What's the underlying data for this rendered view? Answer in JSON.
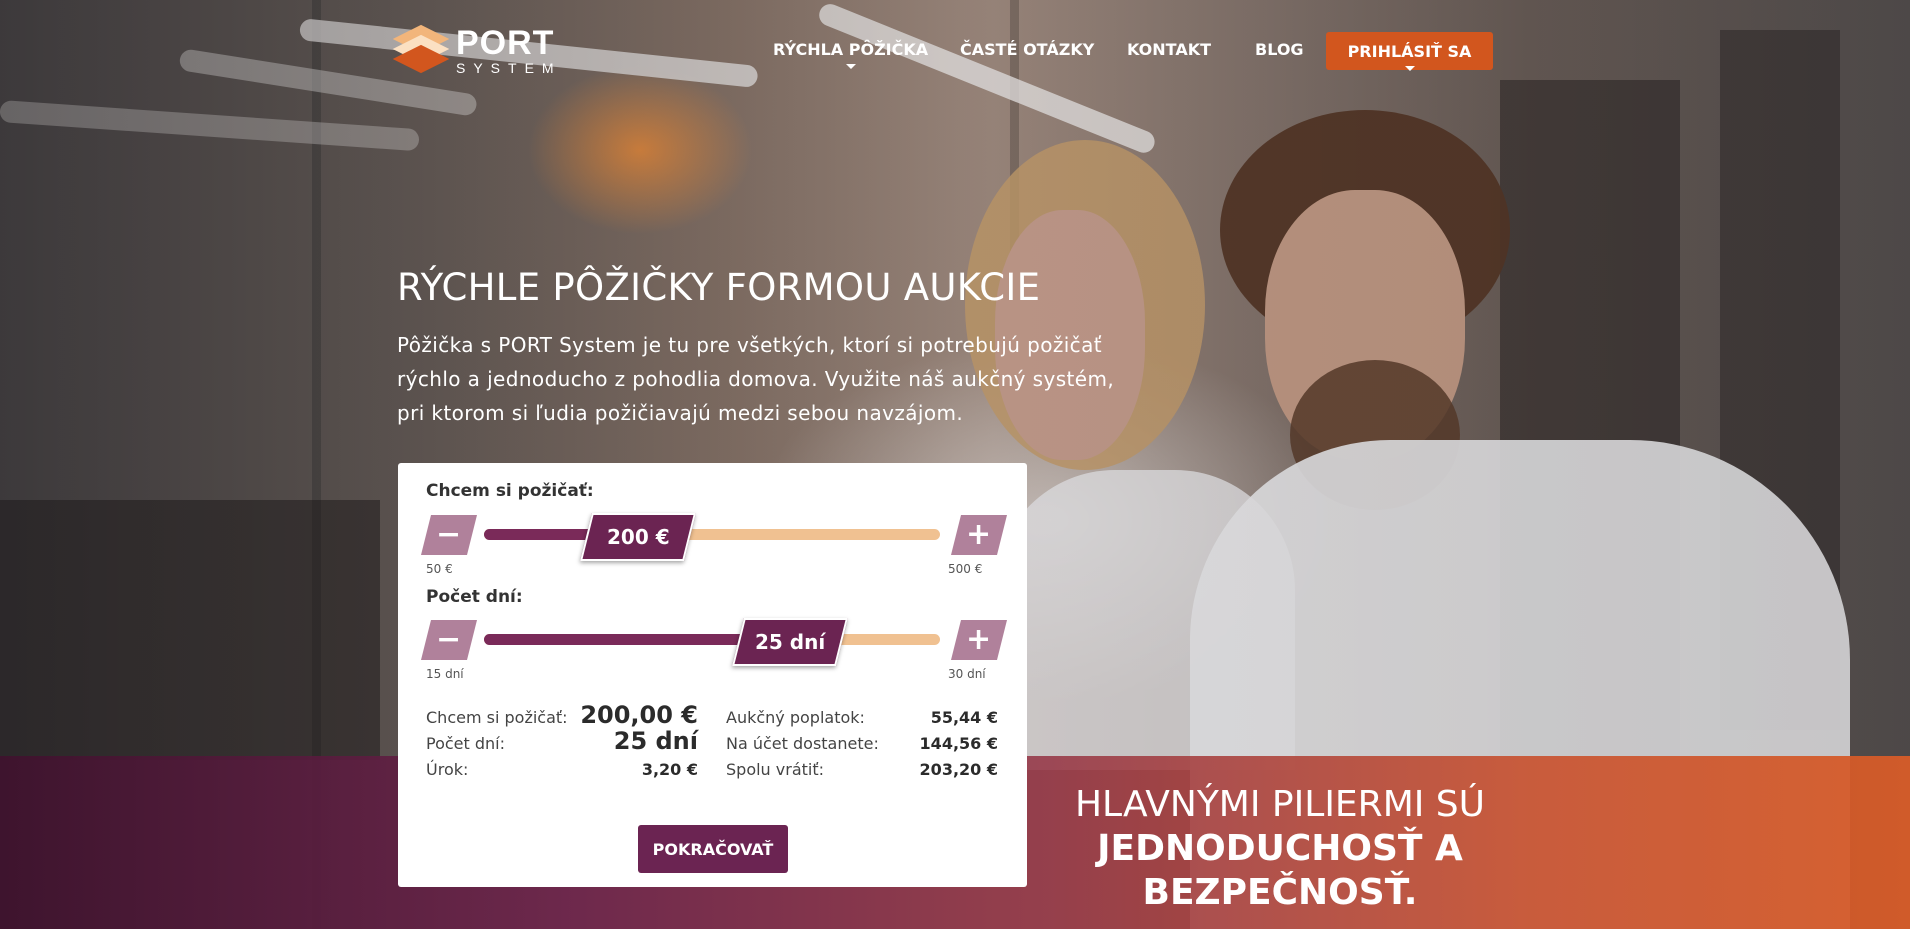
{
  "logo": {
    "title": "PORT",
    "subtitle": "SYSTEM"
  },
  "nav": {
    "items": [
      {
        "label": "RÝCHLA PÔŽIČKA"
      },
      {
        "label": "ČASTÉ OTÁZKY"
      },
      {
        "label": "KONTAKT"
      },
      {
        "label": "BLOG"
      }
    ],
    "login_label": "PRIHLÁSIŤ SA"
  },
  "hero": {
    "title": "RÝCHLE PÔŽIČKY FORMOU AUKCIE",
    "text": "Pôžička s PORT System je tu pre všetkých, ktorí si potrebujú požičať rýchlo a jednoducho z pohodlia domova. Využite náš aukčný systém, pri ktorom si ľudia požičiavajú medzi sebou navzájom."
  },
  "calculator": {
    "amount": {
      "label": "Chcem si požičať:",
      "value_label": "200 €",
      "min_label": "50 €",
      "max_label": "500 €",
      "minus": "−",
      "plus": "+",
      "level": 0.333
    },
    "days": {
      "label": "Počet dní:",
      "value_label": "25 dní",
      "min_label": "15 dní",
      "max_label": "30 dní",
      "minus": "−",
      "plus": "+",
      "level": 0.667
    },
    "summary": {
      "left": [
        {
          "label": "Chcem si požičať:",
          "value": "200,00 €"
        },
        {
          "label": "Počet dní:",
          "value": "25 dní"
        },
        {
          "label": "Úrok:",
          "value": "3,20 €"
        }
      ],
      "right": [
        {
          "label": "Aukčný poplatok:",
          "value": "55,44 €"
        },
        {
          "label": "Na účet dostanete:",
          "value": "144,56 €"
        },
        {
          "label": "Spolu vrátiť:",
          "value": "203,20 €"
        }
      ]
    },
    "cta_label": "POKRAČOVAŤ"
  },
  "band": {
    "line1": "HLAVNÝMI PILIERMI SÚ",
    "line2": "JEDNODUCHOSŤ A BEZPEČNOSŤ."
  },
  "colors": {
    "accent_orange": "#d2561e",
    "brand_purple": "#6b2452",
    "track_light": "#f0c191",
    "stepper": "#b0819b"
  }
}
